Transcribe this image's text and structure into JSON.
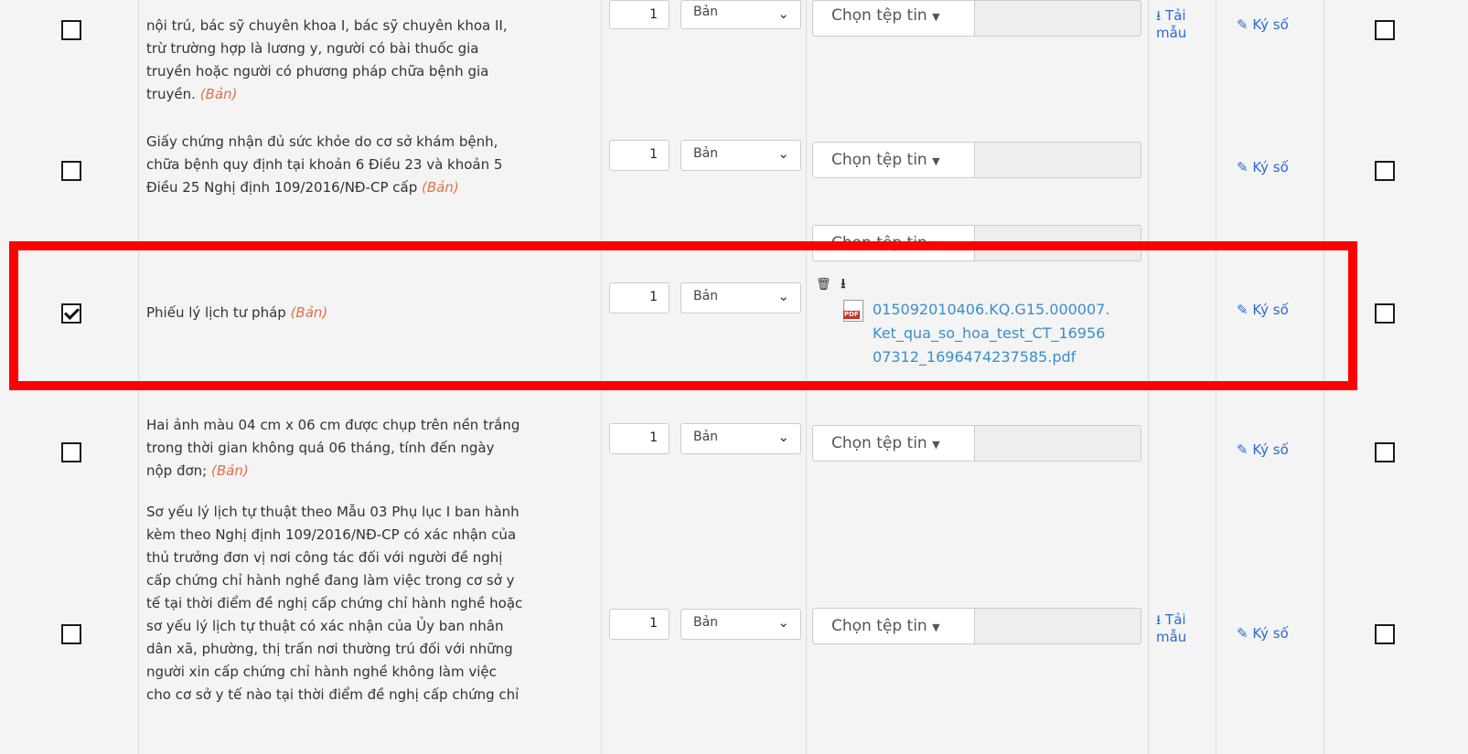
{
  "rows": [
    {
      "checked": false,
      "desc_lines": [
        "nội trú, bác sỹ chuyên khoa I, bác sỹ chuyên khoa II,",
        "trừ trường hợp là lương y, người có bài thuốc gia",
        "truyền hoặc người có phương pháp chữa bệnh gia",
        "truyền."
      ],
      "tag": "(Bản)",
      "qty": "1",
      "type": "Bản",
      "file_button": "Chọn tệp tin",
      "download_lines": [
        "Tải",
        "mẫu"
      ],
      "sign": "Ký số"
    },
    {
      "checked": false,
      "desc_lines": [
        "Giấy chứng nhận đủ sức khỏe do cơ sở khám bệnh,",
        "chữa bệnh quy định tại khoản 6 Điều 23 và khoản 5",
        "Điều 25 Nghị định 109/2016/NĐ-CP cấp"
      ],
      "tag": "(Bản)",
      "qty": "1",
      "type": "Bản",
      "file_button": "Chọn tệp tin",
      "sign": "Ký số"
    },
    {
      "checked": true,
      "desc_lines": [
        "Phiếu lý lịch tư pháp"
      ],
      "tag": "(Bản)",
      "qty": "1",
      "type": "Bản",
      "file_button": "Chọn tệp tin",
      "file_name_lines": [
        "015092010406.KQ.G15.000007.",
        "Ket_qua_so_hoa_test_CT_16956",
        "07312_1696474237585.pdf"
      ],
      "sign": "Ký số"
    },
    {
      "checked": false,
      "desc_lines": [
        "Hai ảnh màu 04 cm x 06 cm được chụp trên nền trắng",
        "trong thời gian không quá 06 tháng, tính đến ngày",
        "nộp đơn;"
      ],
      "tag": "(Bản)",
      "qty": "1",
      "type": "Bản",
      "file_button": "Chọn tệp tin",
      "sign": "Ký số"
    },
    {
      "checked": false,
      "desc_lines": [
        "Sơ yếu lý lịch tự thuật theo Mẫu 03 Phụ lục I ban hành",
        "kèm theo Nghị định 109/2016/NĐ-CP có xác nhận của",
        "thủ trưởng đơn vị nơi công tác đối với người đề nghị",
        "cấp chứng chỉ hành nghề đang làm việc trong cơ sở y",
        "tế tại thời điểm đề nghị cấp chứng chỉ hành nghề hoặc",
        "sơ yếu lý lịch tự thuật có xác nhận của Ủy ban nhân",
        "dân xã, phường, thị trấn nơi thường trú đối với những",
        "người xin cấp chứng chỉ hành nghề không làm việc",
        "cho cơ sở y tế nào tại thời điểm đề nghị cấp chứng chỉ"
      ],
      "qty": "1",
      "type": "Bản",
      "file_button": "Chọn tệp tin",
      "download_lines": [
        "Tải",
        "mẫu"
      ],
      "sign": "Ký số"
    }
  ],
  "colors": {
    "link": "#2a6bd3",
    "file_link": "#3a8ec9",
    "tag": "#e0704a",
    "highlight": "#ff0000"
  }
}
